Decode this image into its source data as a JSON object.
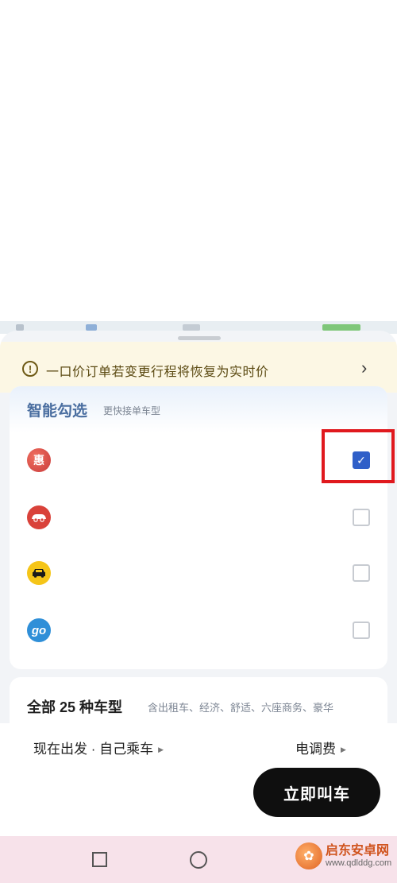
{
  "notice": {
    "icon": "exclamation-circle-icon",
    "text": "一口价订单若变更行程将恢复为实时价",
    "arrow": "›"
  },
  "smart_select": {
    "title": "智能勾选",
    "subtitle": "更快接单车型",
    "items": [
      {
        "logo": "hui-logo-icon",
        "logo_text": "惠",
        "checked": true
      },
      {
        "logo": "car-logo-icon",
        "logo_text": "",
        "checked": false
      },
      {
        "logo": "taxi-logo-icon",
        "logo_text": "",
        "checked": false
      },
      {
        "logo": "go-logo-icon",
        "logo_text": "go",
        "checked": false
      }
    ]
  },
  "all_types": {
    "title": "全部 25 种车型",
    "subtitle": "含出租车、经济、舒适、六座商务、豪华"
  },
  "bottom": {
    "depart": "现在出发 · 自己乘车",
    "fee": "电调费",
    "call_button": "立即叫车"
  },
  "navbar": {
    "icons": [
      "recent-apps-icon",
      "home-icon"
    ]
  },
  "watermark": {
    "name": "启东安卓网",
    "url": "www.qdlddg.com"
  },
  "colors": {
    "accent": "#2f5fc8",
    "highlight_box": "#e0191e",
    "notice_bg": "#fcf7e4",
    "button_bg": "#0f0f0f"
  }
}
